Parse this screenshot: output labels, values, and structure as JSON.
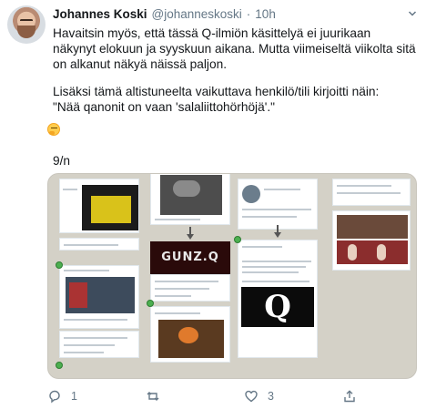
{
  "author": {
    "name": "Johannes Koski",
    "handle": "@johanneskoski",
    "separator": "·",
    "time": "10h"
  },
  "tweet": {
    "paragraph1": "Havaitsin myös, että tässä Q-ilmiön käsittelyä ei juurikaan näkynyt elokuun ja syyskuun aikana. Mutta viimeiseltä viikolta sitä on alkanut näkyä näissä paljon.",
    "paragraph2": "Lisäksi tämä altistuneelta vaikuttava henkilö/tili kirjoitti näin:\n\"Nää qanonit on vaan 'salaliittohörhöjä'.\"",
    "emoji": "thinking-face-emoji",
    "thread_counter": "9/n"
  },
  "media": {
    "panels": {
      "gunz_text": "GUNZ.Q",
      "q_letter": "Q"
    }
  },
  "actions": {
    "reply_count": "1",
    "retweet_count": "",
    "like_count": "3"
  },
  "colors": {
    "text": "#14171a",
    "secondary": "#657786",
    "media_bg": "#d4d1c7"
  }
}
